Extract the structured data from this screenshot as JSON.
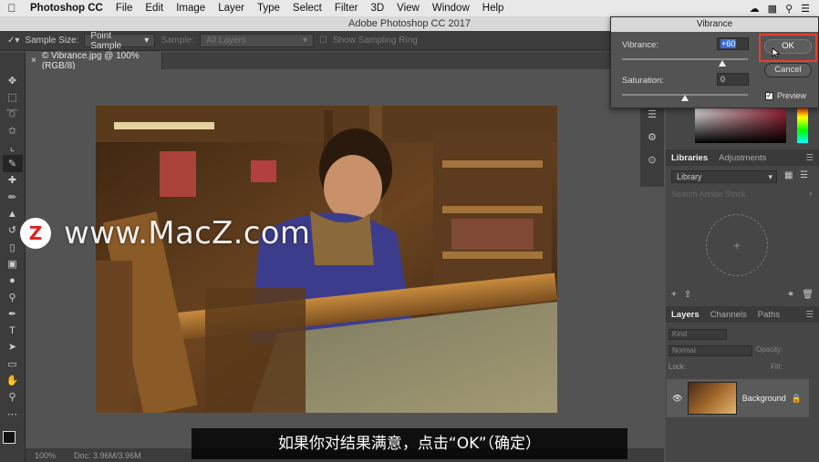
{
  "menubar": {
    "app_name": "Photoshop CC",
    "items": [
      "File",
      "Edit",
      "Image",
      "Layer",
      "Type",
      "Select",
      "Filter",
      "3D",
      "View",
      "Window",
      "Help"
    ]
  },
  "window": {
    "title": "Adobe Photoshop CC 2017"
  },
  "options": {
    "sample_size_label": "Sample Size:",
    "sample_size_value": "Point Sample",
    "sample_label": "Sample:",
    "sample_value": "All Layers",
    "show_ring_label": "Show Sampling Ring"
  },
  "document": {
    "tab_label": "© Vibrance.jpg @ 100% (RGB/8)",
    "zoom": "100%",
    "doc_info": "Doc: 3.96M/3.96M"
  },
  "dialog": {
    "title": "Vibrance",
    "vibrance_label": "Vibrance:",
    "vibrance_value": "+60",
    "vibrance_level": 60,
    "saturation_label": "Saturation:",
    "saturation_value": "0",
    "saturation_level": 0,
    "ok_label": "OK",
    "cancel_label": "Cancel",
    "preview_label": "Preview",
    "preview_checked": true
  },
  "libraries": {
    "tabs": [
      "Libraries",
      "Adjustments"
    ],
    "active_tab": "Libraries",
    "library_select": "Library",
    "search_placeholder": "Search Adobe Stock"
  },
  "layers": {
    "tabs": [
      "Layers",
      "Channels",
      "Paths"
    ],
    "kind_filter": "Kind",
    "blend_mode": "Normal",
    "opacity_label": "Opacity:",
    "lock_label": "Lock:",
    "fill_label": "Fill:",
    "items": [
      {
        "name": "Background"
      }
    ]
  },
  "watermark": {
    "badge": "Z",
    "text": "www.MacZ.com"
  },
  "subtitle": "如果你对结果满意，点击“OK”（确定）",
  "colors": {
    "highlight": "#ef3b2f",
    "selection": "#3b6ddb",
    "watermark_badge": "#e0221f"
  }
}
